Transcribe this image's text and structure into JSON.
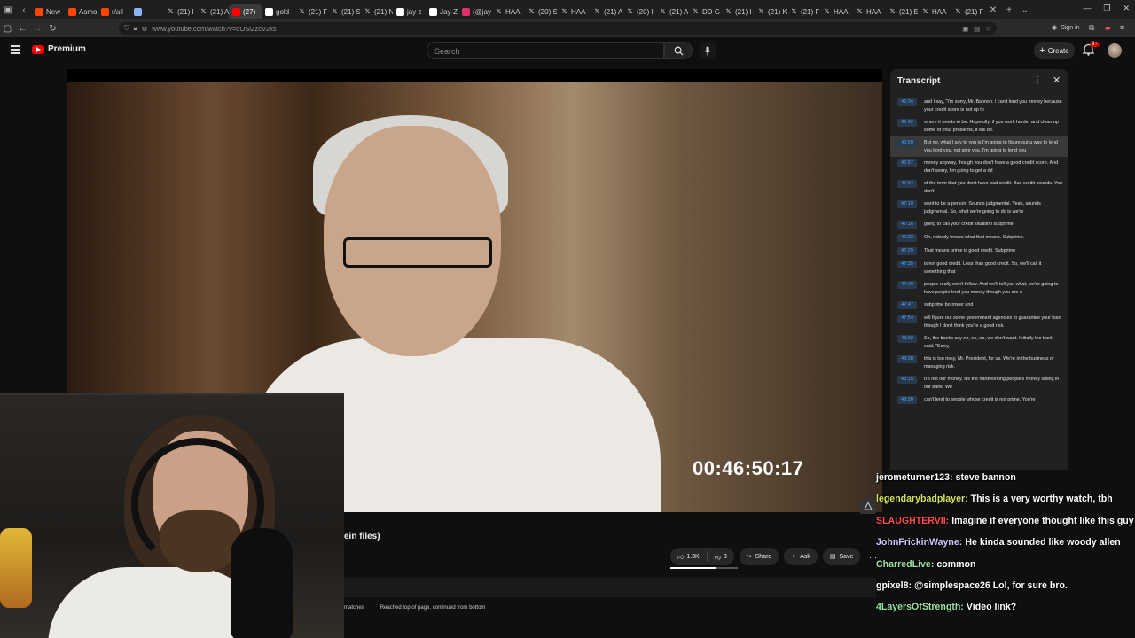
{
  "browser": {
    "tabs": [
      {
        "label": "New",
        "icon": "reddit-icon",
        "color": "#ff4500"
      },
      {
        "label": "Asmo",
        "icon": "reddit-icon",
        "color": "#ff4500"
      },
      {
        "label": "r/all",
        "icon": "reddit-icon",
        "color": "#ff4500"
      },
      {
        "label": "",
        "icon": "app-icon",
        "color": "#8ab4f8"
      },
      {
        "label": "(21) I",
        "icon": "x-icon",
        "color": "#ffffff"
      },
      {
        "label": "(21) A",
        "icon": "x-icon",
        "color": "#ffffff"
      },
      {
        "label": "(27)",
        "icon": "youtube-icon",
        "color": "#ff0000",
        "active": true
      },
      {
        "label": "gold",
        "icon": "google-icon",
        "color": "#ffffff"
      },
      {
        "label": "(21) F",
        "icon": "x-icon",
        "color": "#ffffff"
      },
      {
        "label": "(21) S",
        "icon": "x-icon",
        "color": "#ffffff"
      },
      {
        "label": "(21) N",
        "icon": "x-icon",
        "color": "#ffffff"
      },
      {
        "label": "jay z",
        "icon": "google-icon",
        "color": "#ffffff"
      },
      {
        "label": "Jay-Z",
        "icon": "wiki-icon",
        "color": "#ffffff"
      },
      {
        "label": "(@jay",
        "icon": "instagram-icon",
        "color": "#e1306c"
      },
      {
        "label": "HAA",
        "icon": "x-icon",
        "color": "#ffffff"
      },
      {
        "label": "(20) S",
        "icon": "x-icon",
        "color": "#ffffff"
      },
      {
        "label": "HAA",
        "icon": "x-icon",
        "color": "#ffffff"
      },
      {
        "label": "(21) A",
        "icon": "x-icon",
        "color": "#ffffff"
      },
      {
        "label": "(20) I",
        "icon": "x-icon",
        "color": "#ffffff"
      },
      {
        "label": "(21) A",
        "icon": "x-icon",
        "color": "#ffffff"
      },
      {
        "label": "DD G",
        "icon": "x-icon",
        "color": "#ffffff"
      },
      {
        "label": "(21) I",
        "icon": "x-icon",
        "color": "#ffffff"
      },
      {
        "label": "(21) K",
        "icon": "x-icon",
        "color": "#ffffff"
      },
      {
        "label": "(21) F",
        "icon": "x-icon",
        "color": "#ffffff"
      },
      {
        "label": "HAA",
        "icon": "x-icon",
        "color": "#ffffff"
      },
      {
        "label": "HAA",
        "icon": "x-icon",
        "color": "#ffffff"
      },
      {
        "label": "(21) E",
        "icon": "x-icon",
        "color": "#ffffff"
      },
      {
        "label": "HAA",
        "icon": "x-icon",
        "color": "#ffffff"
      },
      {
        "label": "(21) F",
        "icon": "x-icon",
        "color": "#ffffff"
      }
    ],
    "url": "www.youtube.com/watch?v=dOSlZzcV2ks",
    "sign_in": "Sign in"
  },
  "youtube": {
    "logo_label": "Premium",
    "search_placeholder": "Search",
    "create_label": "Create",
    "notif_badge": "9+"
  },
  "video": {
    "timecode": "00:46:50:17",
    "title_fragment": "ein files)"
  },
  "actions": {
    "likes": "1.3K",
    "dislikes": "3",
    "share": "Share",
    "ask": "Ask",
    "save": "Save",
    "like_ratio": 0.68
  },
  "transcript": {
    "title": "Transcript",
    "segments": [
      {
        "ts": "46:34",
        "text": "and I say, \"I'm sorry, Mr. Bannon. I can't lend you money because your credit score is not up to"
      },
      {
        "ts": "46:42",
        "text": "where it needs to be. Hopefully, if you work harder and clean up some of your problems, it will be."
      },
      {
        "ts": "46:50",
        "text": "But no, what I say to you is I'm going to figure out a way to lend you lend you, not give you, I'm going to lend you",
        "active": true
      },
      {
        "ts": "46:57",
        "text": "money anyway, though you don't have a good credit score. And don't worry, I'm going to get a rid"
      },
      {
        "ts": "47:04",
        "text": "of the term that you don't have bad credit. Bad credit sounds. You don't"
      },
      {
        "ts": "47:10",
        "text": "want to be a person. Sounds judgmental. Yeah, sounds judgmental. So, what we're going to do is we're"
      },
      {
        "ts": "47:16",
        "text": "going to call your credit situation subprime."
      },
      {
        "ts": "47:23",
        "text": "Oh, nobody knows what that means. Subprime."
      },
      {
        "ts": "47:29",
        "text": "That means prime is good credit. Subprime"
      },
      {
        "ts": "47:35",
        "text": "is not good credit. Less than good credit. So, we'll call it something that"
      },
      {
        "ts": "47:40",
        "text": "people really won't follow. And we'll tell you what, we're going to have people lend you money though you are a"
      },
      {
        "ts": "47:47",
        "text": "subprime borrower and I"
      },
      {
        "ts": "47:54",
        "text": "will figure out some government agencies to guarantee your loan though I don't think you're a good risk."
      },
      {
        "ts": "48:02",
        "text": "So, the banks say no, no, no, we don't want. Initially the bank said, \"Sorry,"
      },
      {
        "ts": "48:08",
        "text": "this is too risky, Mr. President, for us. We're in the business of managing risk."
      },
      {
        "ts": "48:15",
        "text": "It's not our money. It's the hardworking people's money sitting in our bank. We"
      },
      {
        "ts": "48:20",
        "text": "can't lend to people whose credit is not prime. You're"
      }
    ]
  },
  "findbar": {
    "matches": "matches",
    "status": "Reached top of page, continued from bottom"
  },
  "chat": {
    "messages": [
      {
        "user": "jerometurner123:",
        "text": "steve bannon",
        "color": "#ffffff"
      },
      {
        "user": "legendarybadplayer:",
        "text": "This is a very worthy watch, tbh",
        "color": "#d4e45a"
      },
      {
        "user": "SLAUGHTERVII:",
        "text": "Imagine if everyone thought like this guy",
        "color": "#ff4d4d"
      },
      {
        "user": "JohnFrickinWayne:",
        "text": "He kinda sounded like woody allen",
        "color": "#d4c8ff"
      },
      {
        "user": "CharredLive:",
        "text": "common",
        "color": "#9be3a3"
      },
      {
        "user": "gpixel8:",
        "text": "@simplespace26 Lol, for sure bro.",
        "color": "#ffffff"
      },
      {
        "user": "4LayersOfStrength:",
        "text": "Video link?",
        "color": "#9be3a3"
      }
    ]
  }
}
